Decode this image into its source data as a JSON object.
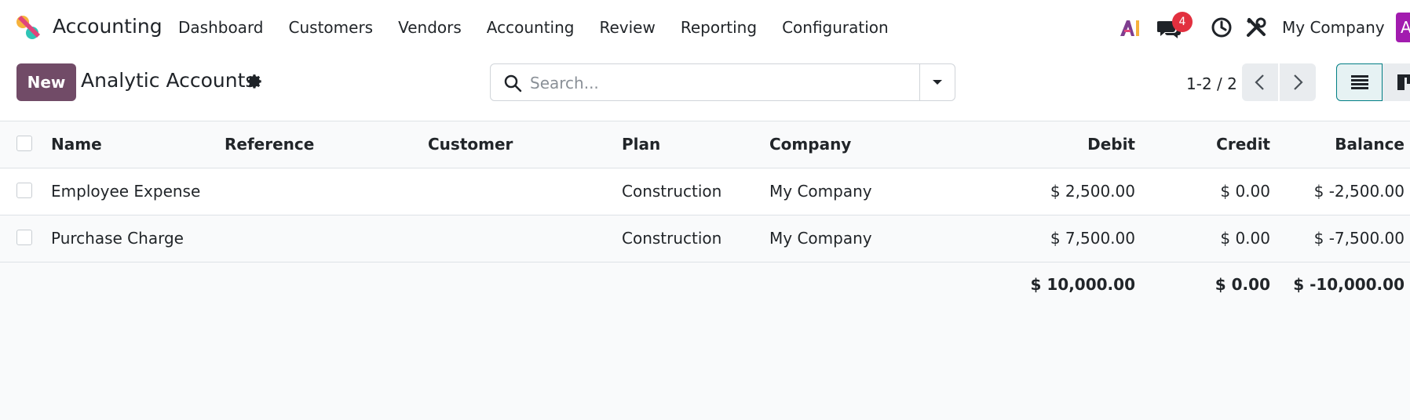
{
  "app": {
    "name": "Accounting",
    "colors": {
      "brand": "#714b67",
      "badge": "#e2303f",
      "accent": "#017e84",
      "avatar": "#a21caf"
    }
  },
  "menu": [
    "Dashboard",
    "Customers",
    "Vendors",
    "Accounting",
    "Review",
    "Reporting",
    "Configuration"
  ],
  "systray": {
    "ai_icon": "ai-icon",
    "messages_badge": "4",
    "company": "My Company",
    "avatar_letter": "A"
  },
  "control_panel": {
    "new_label": "New",
    "title": "Analytic Accounts",
    "search_placeholder": "Search...",
    "pager": "1-2 / 2"
  },
  "table": {
    "columns": {
      "name": "Name",
      "reference": "Reference",
      "customer": "Customer",
      "plan": "Plan",
      "company": "Company",
      "debit": "Debit",
      "credit": "Credit",
      "balance": "Balance"
    },
    "rows": [
      {
        "name": "Employee Expense",
        "reference": "",
        "customer": "",
        "plan": "Construction",
        "company": "My Company",
        "debit": "$ 2,500.00",
        "credit": "$ 0.00",
        "balance": "$ -2,500.00"
      },
      {
        "name": "Purchase Charge",
        "reference": "",
        "customer": "",
        "plan": "Construction",
        "company": "My Company",
        "debit": "$ 7,500.00",
        "credit": "$ 0.00",
        "balance": "$ -7,500.00"
      }
    ],
    "totals": {
      "debit": "$ 10,000.00",
      "credit": "$ 0.00",
      "balance": "$ -10,000.00"
    }
  }
}
